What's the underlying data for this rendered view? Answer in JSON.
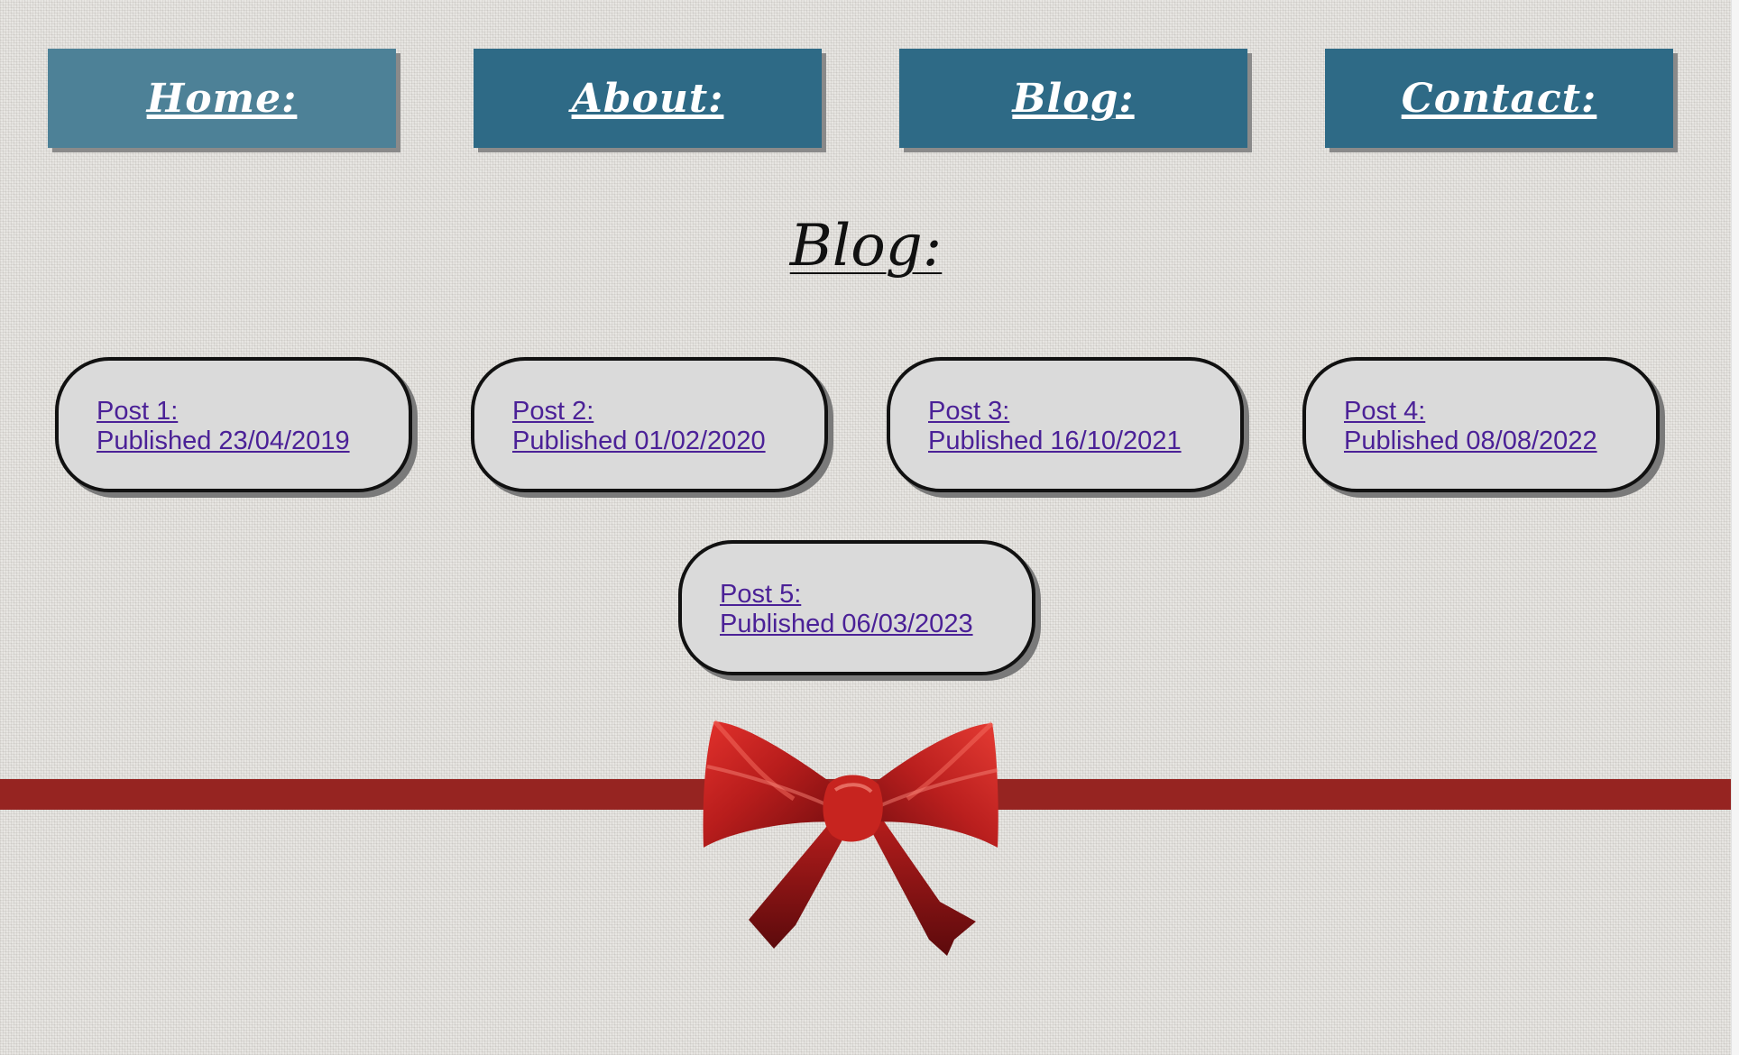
{
  "nav": {
    "items": [
      {
        "label": "Home:"
      },
      {
        "label": "About:"
      },
      {
        "label": "Blog:"
      },
      {
        "label": "Contact:"
      }
    ]
  },
  "page": {
    "heading": "Blog:"
  },
  "posts": [
    {
      "title": "Post 1:",
      "published": "Published 23/04/2019"
    },
    {
      "title": "Post 2:",
      "published": "Published 01/02/2020"
    },
    {
      "title": "Post 3:",
      "published": "Published 16/10/2021"
    },
    {
      "title": "Post 4:",
      "published": "Published 08/08/2022"
    },
    {
      "title": "Post 5:",
      "published": "Published 06/03/2023"
    }
  ],
  "colors": {
    "nav_button": "#2e6a86",
    "nav_button_active": "#4d8197",
    "post_card": "#dadada",
    "link": "#4b2197",
    "ribbon": "#962421"
  },
  "icons": {
    "ribbon_bow": "red-bow-icon"
  }
}
